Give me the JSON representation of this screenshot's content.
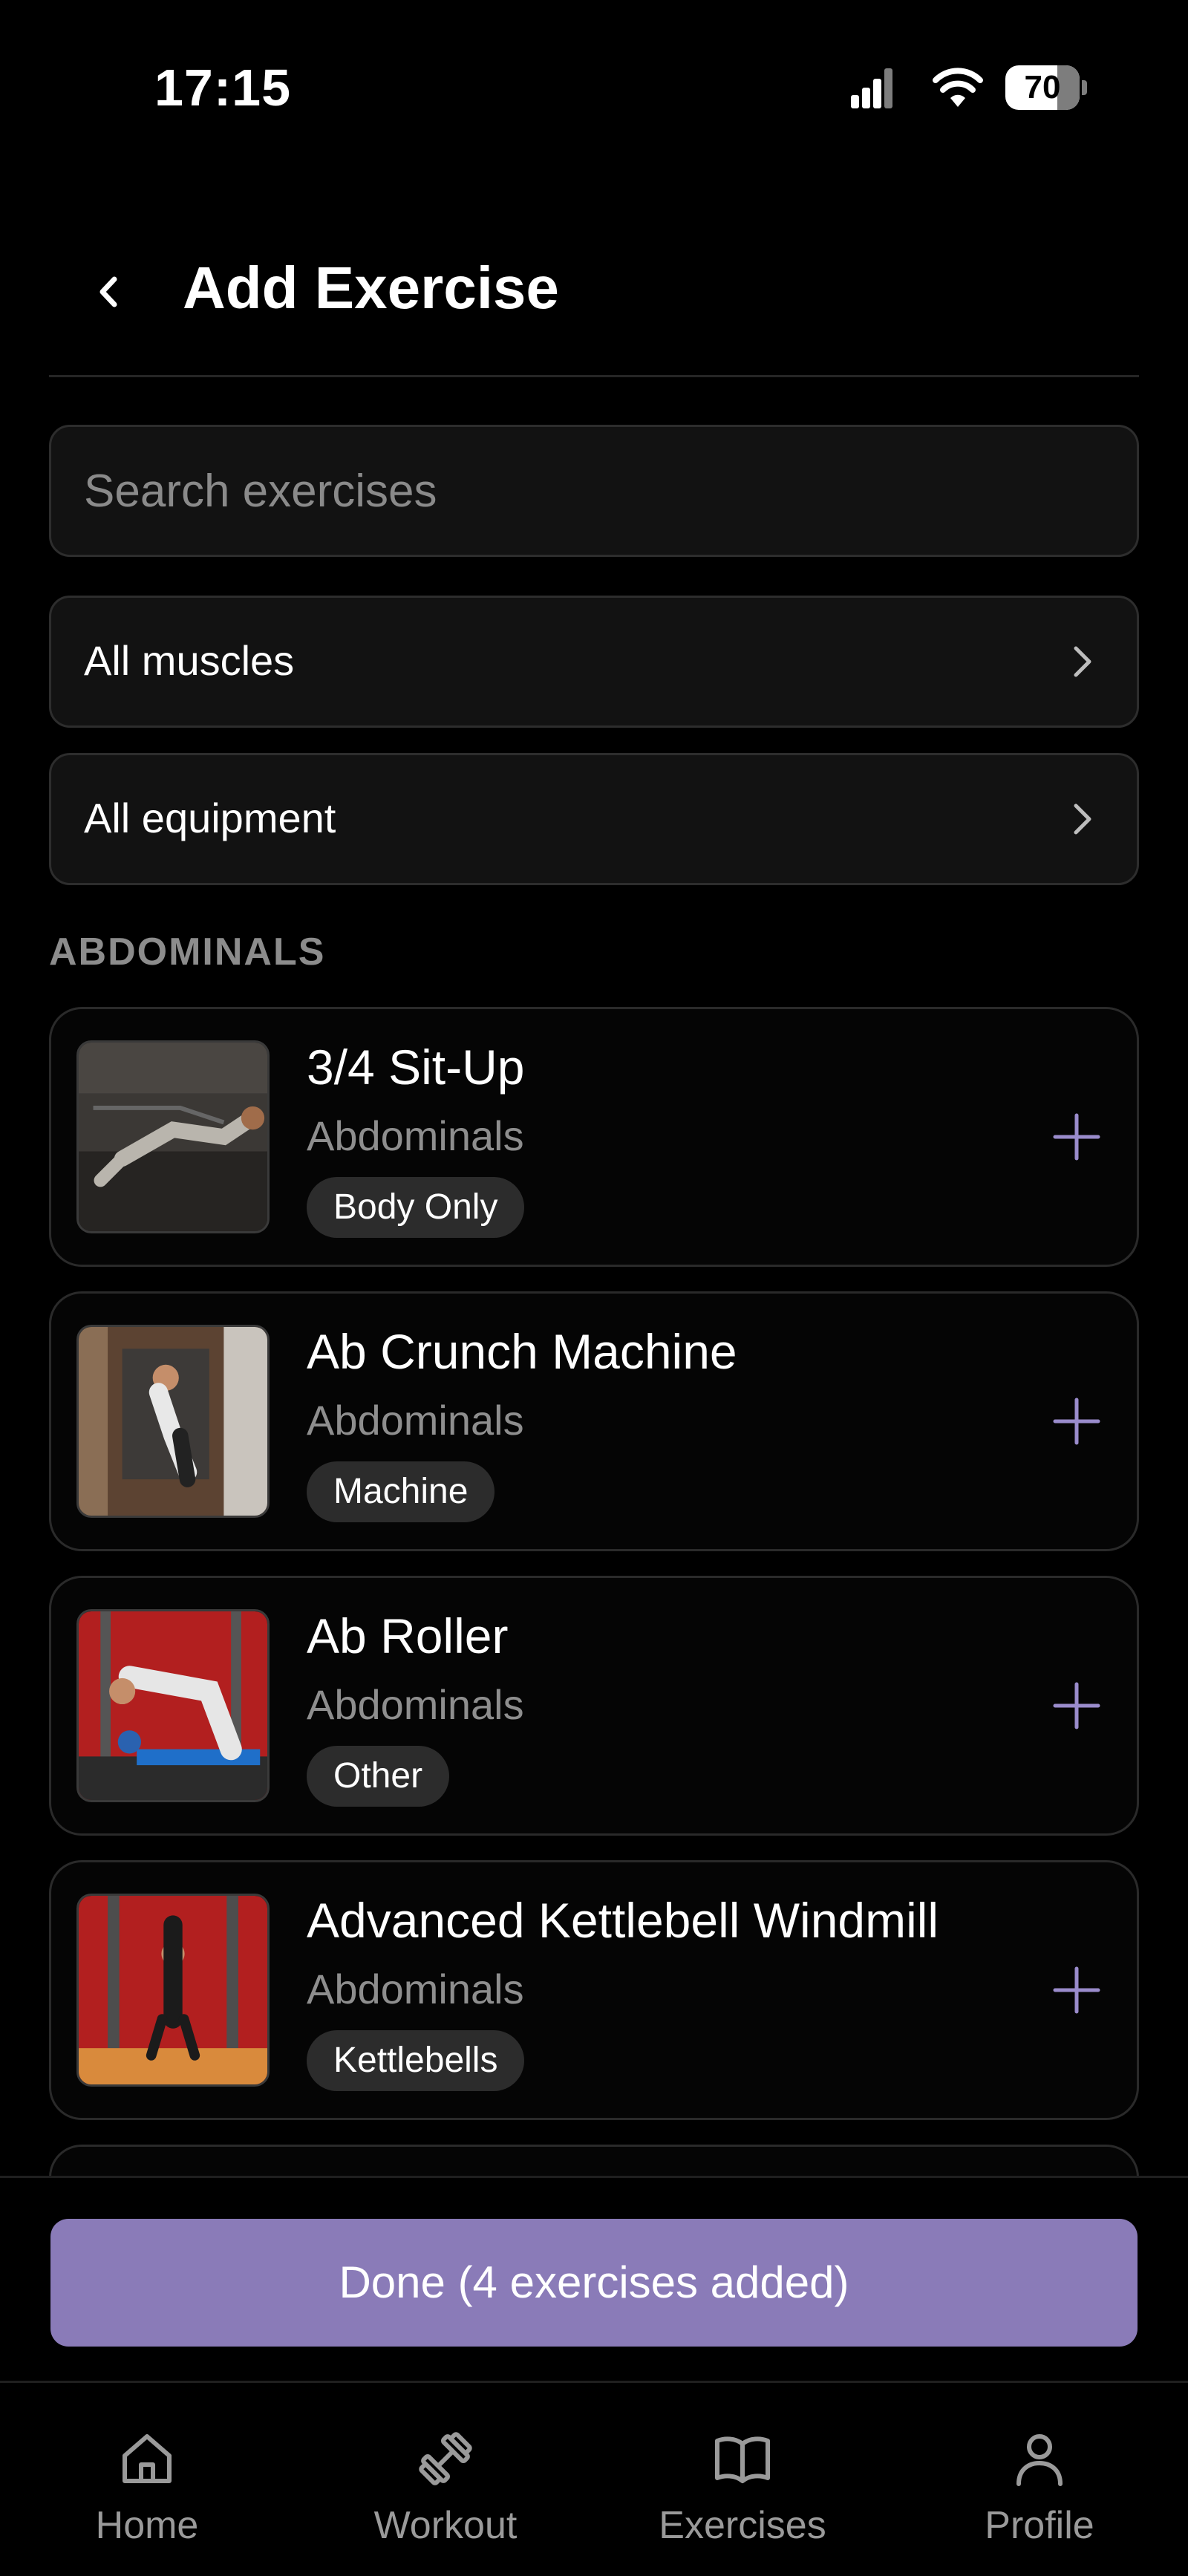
{
  "status_bar": {
    "time": "17:15",
    "battery": "70"
  },
  "header": {
    "title": "Add Exercise"
  },
  "search": {
    "placeholder": "Search exercises",
    "value": ""
  },
  "filters": {
    "muscles_label": "All muscles",
    "equipment_label": "All equipment"
  },
  "section": {
    "title": "ABDOMINALS"
  },
  "exercises": [
    {
      "name": "3/4 Sit-Up",
      "muscle": "Abdominals",
      "equipment": "Body Only"
    },
    {
      "name": "Ab Crunch Machine",
      "muscle": "Abdominals",
      "equipment": "Machine"
    },
    {
      "name": "Ab Roller",
      "muscle": "Abdominals",
      "equipment": "Other"
    },
    {
      "name": "Advanced Kettlebell Windmill",
      "muscle": "Abdominals",
      "equipment": "Kettlebells"
    }
  ],
  "done_button": {
    "label": "Done (4 exercises added)"
  },
  "tabs": [
    {
      "label": "Home",
      "icon": "home-icon"
    },
    {
      "label": "Workout",
      "icon": "dumbbell-icon"
    },
    {
      "label": "Exercises",
      "icon": "book-icon"
    },
    {
      "label": "Profile",
      "icon": "person-icon"
    }
  ],
  "colors": {
    "accent": "#8a7bb8",
    "add_icon": "#9a8ccc",
    "background": "#000000",
    "card_border": "#2a2a2a"
  }
}
